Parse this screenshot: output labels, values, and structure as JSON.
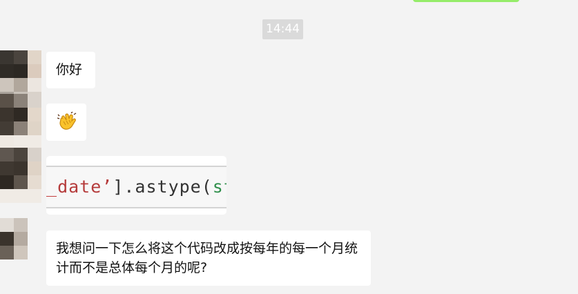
{
  "chat": {
    "timestamp": "14:44",
    "messages": [
      {
        "type": "text",
        "content": "你好"
      },
      {
        "type": "emoji",
        "emoji": "waving-hand-icon"
      },
      {
        "type": "code-image",
        "code_parts": {
          "underscore": "_",
          "key": "date’",
          "rest": "].astype(",
          "type_name": "str"
        }
      },
      {
        "type": "text",
        "content": "我想问一下怎么将这个代码改成按每年的每一个月统计而不是总体每个月的呢?"
      }
    ]
  },
  "colors": {
    "background": "#f3f3f3",
    "bubble_incoming": "#ffffff",
    "bubble_outgoing": "#95ec69",
    "timestamp_bg": "#dadada",
    "timestamp_text": "#ffffff"
  }
}
